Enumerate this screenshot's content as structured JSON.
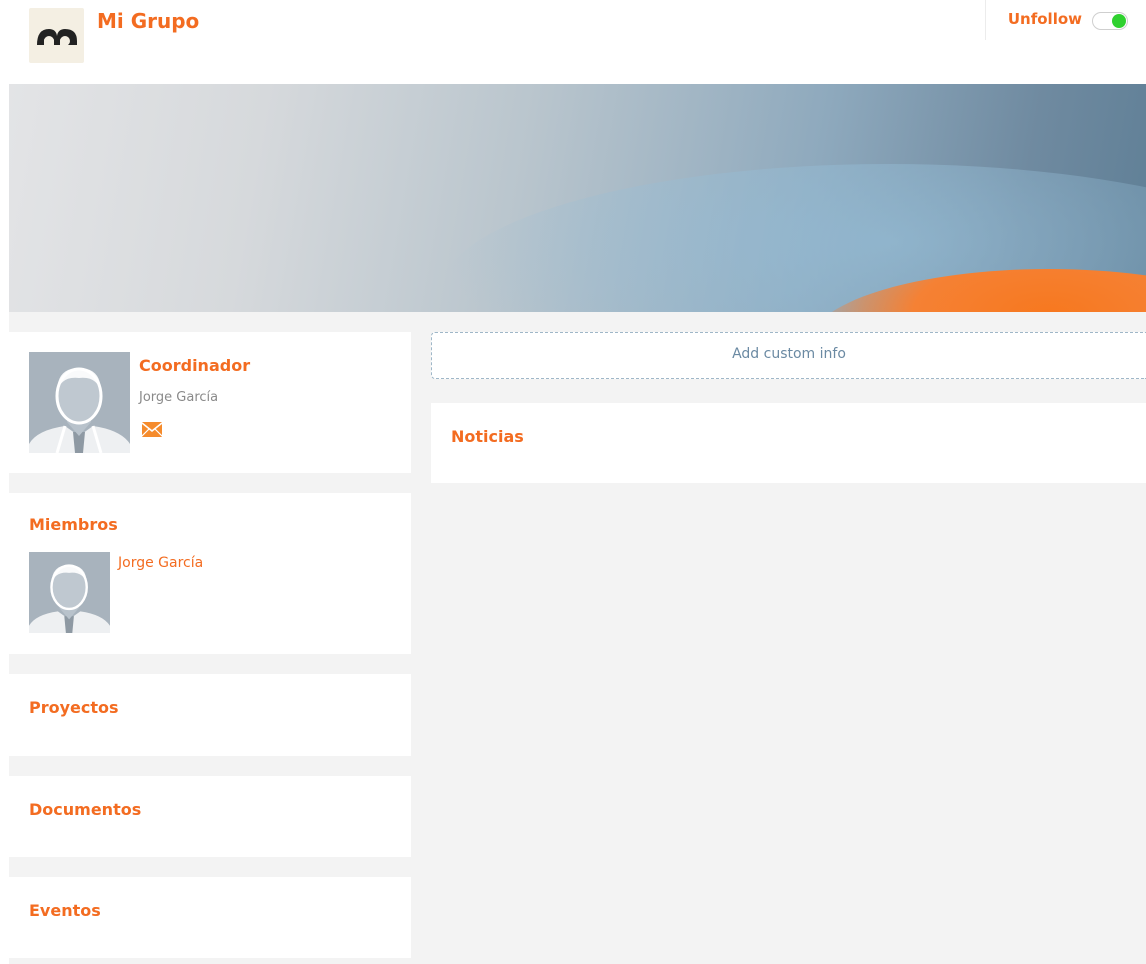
{
  "header": {
    "group_title": "Mi Grupo",
    "follow_label": "Unfollow",
    "follow_toggle_on": true
  },
  "coordinator": {
    "title": "Coordinador",
    "name": "Jorge García"
  },
  "members": {
    "title": "Miembros",
    "items": [
      {
        "name": "Jorge García"
      }
    ]
  },
  "projects": {
    "title": "Proyectos"
  },
  "documents": {
    "title": "Documentos"
  },
  "events": {
    "title": "Eventos"
  },
  "custom_info": {
    "label": "Add custom info"
  },
  "news": {
    "title": "Noticias"
  },
  "colors": {
    "accent": "#f36c21",
    "toggle_on": "#2fd12f",
    "panel_bg": "#f3f3f3"
  },
  "icons": [
    "logo-icon",
    "avatar-icon",
    "mail-icon",
    "toggle-switch"
  ]
}
